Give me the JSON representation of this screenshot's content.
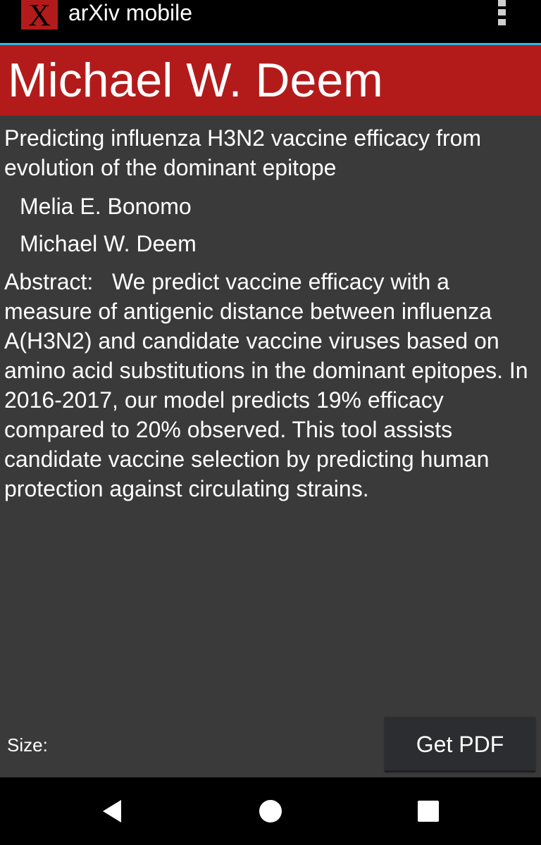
{
  "app": {
    "title": "arXiv mobile",
    "logo_letter": "X",
    "brand_color": "#b31b1b",
    "accent_color": "#33b5e5",
    "overflow_icon": "more-vertical-icon"
  },
  "author_header": {
    "name": "Michael W. Deem"
  },
  "paper": {
    "title": "Predicting influenza H3N2 vaccine efficacy from evolution of the dominant epitope",
    "authors": [
      "Melia E. Bonomo",
      "Michael W. Deem"
    ],
    "abstract_label": "Abstract:   ",
    "abstract_text": "We predict vaccine efficacy with a measure of antigenic distance between influenza A(H3N2) and candidate vaccine viruses based on amino acid substitutions in the dominant epitopes. In 2016-2017, our model predicts 19% efficacy compared to 20% observed. This tool assists candidate vaccine selection by predicting human protection against circulating strains."
  },
  "footer": {
    "size_label": "Size:",
    "get_pdf_label": "Get PDF"
  },
  "nav_bar": {
    "back_icon": "back-triangle-icon",
    "home_icon": "home-circle-icon",
    "recents_icon": "recents-square-icon"
  }
}
